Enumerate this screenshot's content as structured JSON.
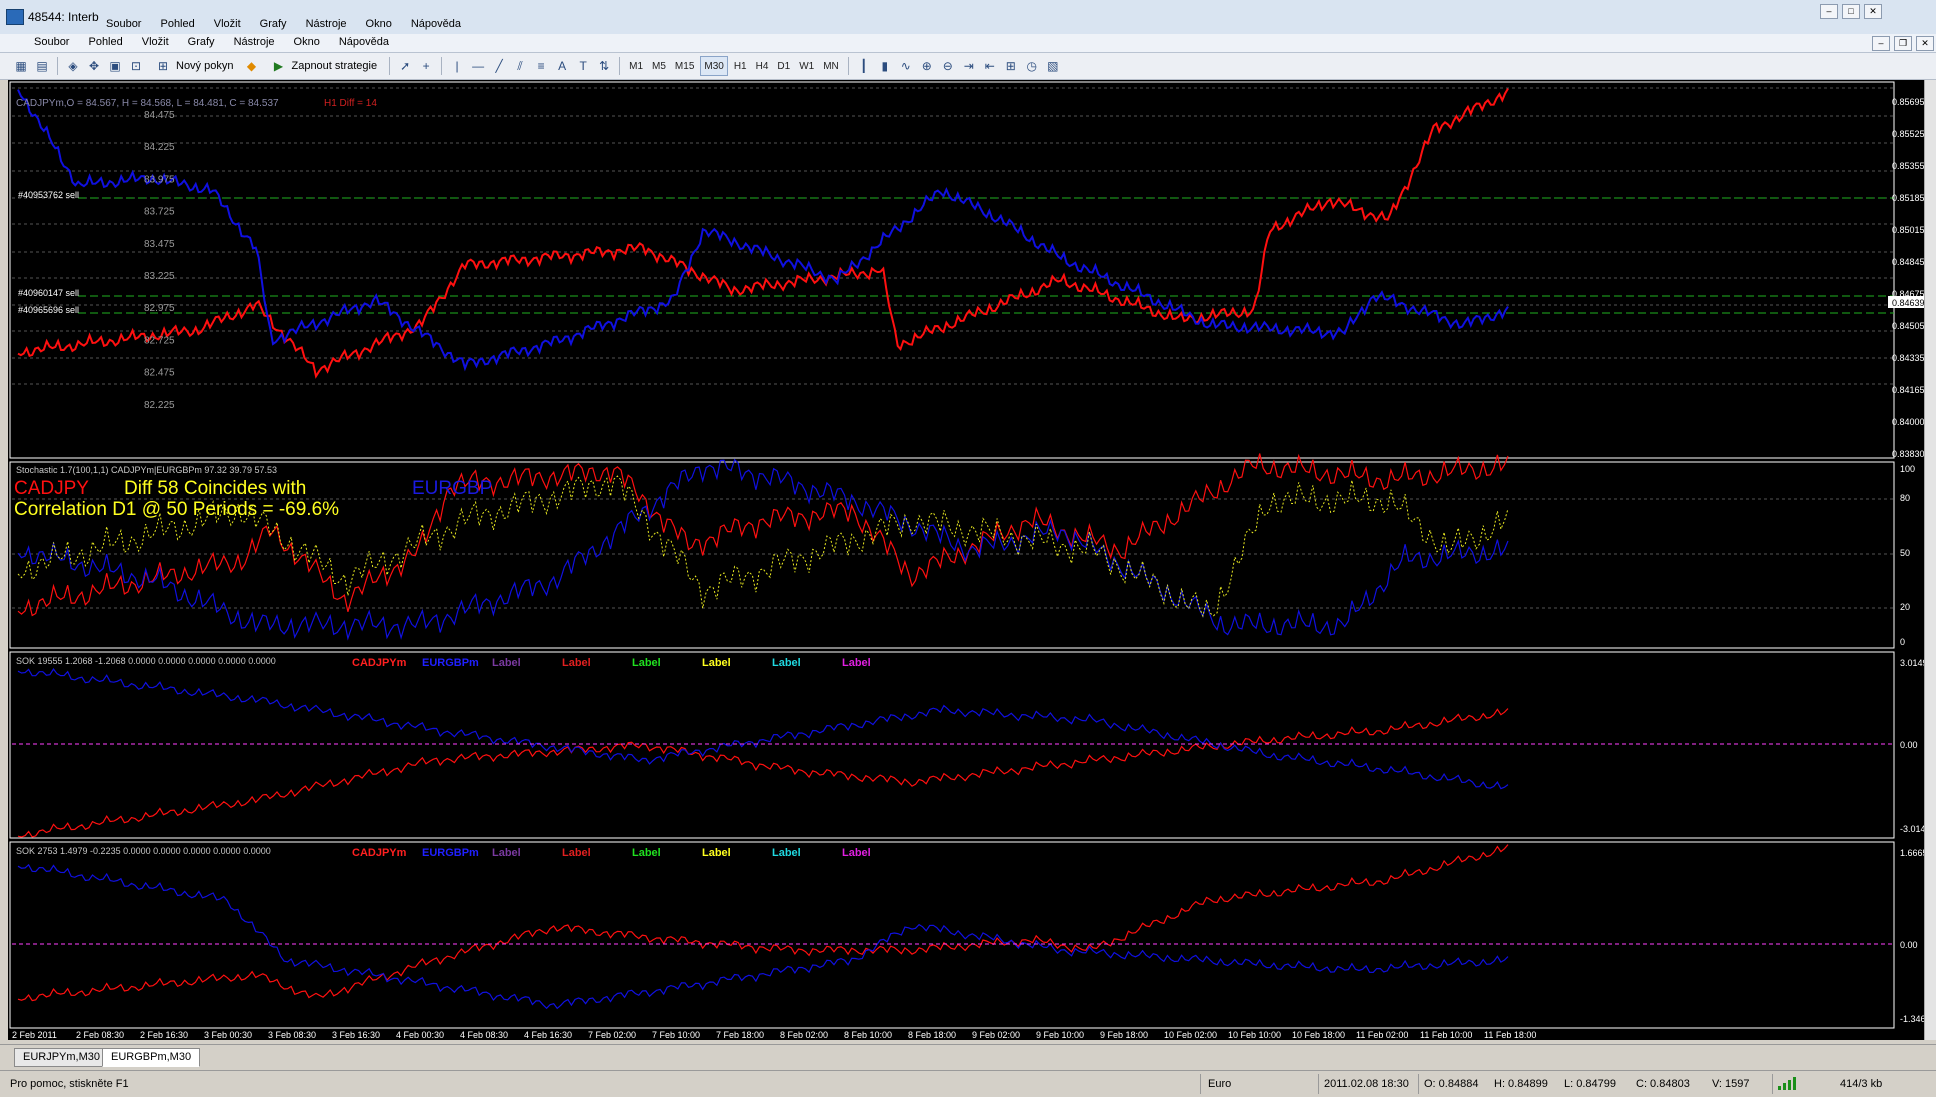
{
  "window": {
    "outer_title": "48544: Interb",
    "outer_menu": [
      "Soubor",
      "Pohled",
      "Vložit",
      "Grafy",
      "Nástroje",
      "Okno",
      "Nápověda"
    ],
    "inner_menu": [
      "Soubor",
      "Pohled",
      "Vložit",
      "Grafy",
      "Nástroje",
      "Okno",
      "Nápověda"
    ]
  },
  "toolbar": {
    "new_order_label": "Nový pokyn",
    "expert_label": "Zapnout strategie",
    "timeframes": [
      "M1",
      "M5",
      "M15",
      "M30",
      "H1",
      "H4",
      "D1",
      "W1",
      "MN"
    ],
    "active_timeframe": "M30"
  },
  "main_chart": {
    "info_line": "CADJPYm,O = 84.567, H = 84.568, L = 84.481, C = 84.537",
    "h1_diff": "H1 Diff = 14",
    "left_scale": [
      "84.475",
      "84.225",
      "83.975",
      "83.725",
      "83.475",
      "83.225",
      "82.975",
      "82.725",
      "82.475",
      "82.225"
    ],
    "right_scale": [
      "0.85695",
      "0.85525",
      "0.85355",
      "0.85185",
      "0.85015",
      "0.84845",
      "0.84675",
      "0.84505",
      "0.84335",
      "0.84165",
      "0.84000",
      "0.83830"
    ],
    "price_tag": "0.84639",
    "orders": [
      "#40953762 sell",
      "#40960147 sell",
      "#40965696 sell"
    ]
  },
  "stoch_panel": {
    "header": "Stochastic 1.7(100,1,1) CADJPYm|EURGBPm 97.32 39.79 57.53",
    "pair1": "CADJPY",
    "diff_text": "Diff 58 Coincides with",
    "corr_text": "Correlation D1 @ 50 Periods = -69.6%",
    "pair2": "EURGBP",
    "scale": [
      "100",
      "80",
      "50",
      "20",
      "0"
    ]
  },
  "sok1": {
    "header": "SOK 19555 1.2068 -1.2068 0.0000 0.0000 0.0000 0.0000 0.0000",
    "labels": [
      "CADJPYm",
      "EURGBPm",
      "Label",
      "Label",
      "Label",
      "Label",
      "Label",
      "Label"
    ],
    "scale": [
      "3.0149",
      "0.00",
      "-3.0149"
    ]
  },
  "sok2": {
    "header": "SOK 2753 1.4979 -0.2235 0.0000 0.0000 0.0000 0.0000 0.0000",
    "labels": [
      "CADJPYm",
      "EURGBPm",
      "Label",
      "Label",
      "Label",
      "Label",
      "Label",
      "Label"
    ],
    "scale": [
      "1.6665",
      "0.00",
      "-1.3466"
    ]
  },
  "colors": {
    "cadjpy": "#ff1010",
    "eurgbp": "#1010e0",
    "stoch_yellow": "#e8e820",
    "label_colors": [
      "#ff2020",
      "#2020ff",
      "#7a3aa0",
      "#e02020",
      "#20e020",
      "#ffff20",
      "#20d8e0",
      "#e020e0"
    ]
  },
  "time_axis": [
    "2 Feb 2011",
    "2 Feb 08:30",
    "2 Feb 16:30",
    "3 Feb 00:30",
    "3 Feb 08:30",
    "3 Feb 16:30",
    "4 Feb 00:30",
    "4 Feb 08:30",
    "4 Feb 16:30",
    "7 Feb 02:00",
    "7 Feb 10:00",
    "7 Feb 18:00",
    "8 Feb 02:00",
    "8 Feb 10:00",
    "8 Feb 18:00",
    "9 Feb 02:00",
    "9 Feb 10:00",
    "9 Feb 18:00",
    "10 Feb 02:00",
    "10 Feb 10:00",
    "10 Feb 18:00",
    "11 Feb 02:00",
    "11 Feb 10:00",
    "11 Feb 18:00"
  ],
  "tabs": [
    "EURJPYm,M30",
    "EURGBPm,M30"
  ],
  "active_tab": "EURGBPm,M30",
  "status": {
    "help": "Pro pomoc, stiskněte F1",
    "profile": "Euro",
    "datetime": "2011.02.08 18:30",
    "open": "O: 0.84884",
    "high": "H: 0.84899",
    "low": "L: 0.84799",
    "close": "C: 0.84803",
    "volume": "V: 1597",
    "traffic": "414/3 kb"
  }
}
